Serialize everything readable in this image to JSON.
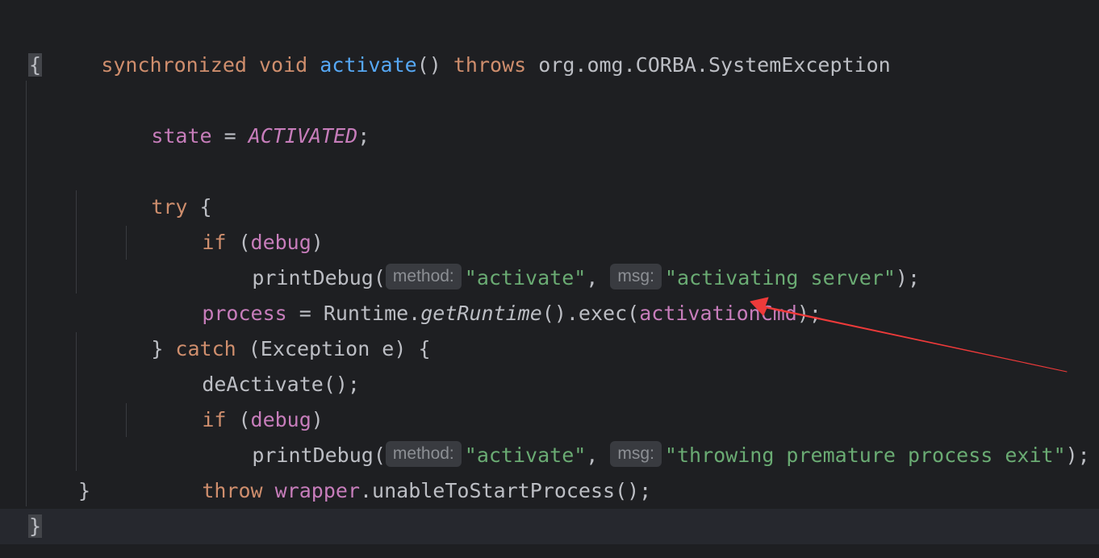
{
  "code": {
    "line1": {
      "kw_synchronized": "synchronized",
      "kw_void": "void",
      "method_name": "activate",
      "parens": "()",
      "kw_throws": "throws",
      "exception_type": "org.omg.CORBA.SystemException"
    },
    "line2": {
      "open_brace": "{"
    },
    "line3": {
      "field_state": "state",
      "assign": " = ",
      "const_activated": "ACTIVATED",
      "semicolon": ";"
    },
    "line5": {
      "kw_try": "try",
      "brace": " {"
    },
    "line6": {
      "kw_if": "if",
      "open": " (",
      "field_debug": "debug",
      "close": ")"
    },
    "line7": {
      "call": "printDebug(",
      "hint_method": "method:",
      "arg1": "\"activate\"",
      "comma": ", ",
      "hint_msg": "msg:",
      "arg2": "\"activating server\"",
      "end": ");"
    },
    "line8": {
      "field_process": "process",
      "assign": " = Runtime.",
      "get_runtime": "getRuntime",
      "exec": "().exec(",
      "field_cmd": "activationCmd",
      "end": ");"
    },
    "line9": {
      "close_brace": "} ",
      "kw_catch": "catch",
      "rest": " (Exception e) {"
    },
    "line10": {
      "text": "deActivate();"
    },
    "line11": {
      "kw_if": "if",
      "open": " (",
      "field_debug": "debug",
      "close": ")"
    },
    "line12": {
      "call": "printDebug(",
      "hint_method": "method:",
      "arg1": "\"activate\"",
      "comma": ", ",
      "hint_msg": "msg:",
      "arg2": "\"throwing premature process exit\"",
      "end": ");"
    },
    "line13": {
      "kw_throw": "throw",
      "field_wrapper": "wrapper",
      "rest": ".unableToStartProcess();"
    },
    "line14": {
      "close_brace": "}"
    },
    "line15": {
      "close_brace": "}"
    }
  },
  "colors": {
    "background": "#1e1f22",
    "keyword": "#cf8e6d",
    "method_declaration": "#56a8f5",
    "field": "#c77dbb",
    "string": "#6aab73",
    "plain": "#bcbec4",
    "inlay_hint_bg": "#393b40",
    "arrow": "#ee3a3a"
  },
  "annotation": {
    "icon": "red-arrow-icon",
    "points_to": "activationCmd"
  }
}
